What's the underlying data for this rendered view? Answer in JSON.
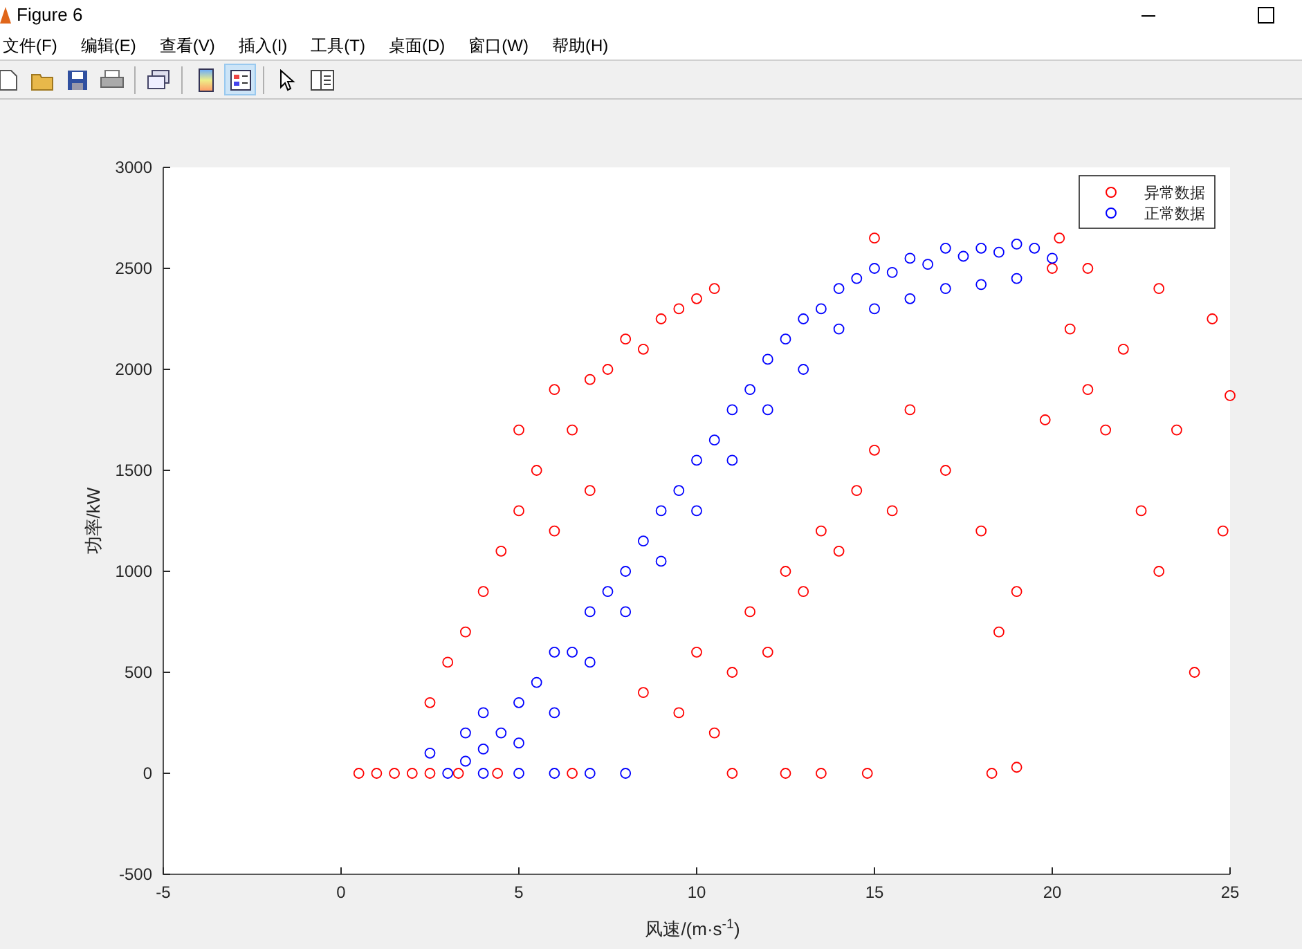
{
  "window": {
    "title": "Figure 6"
  },
  "menu": [
    "文件(F)",
    "编辑(E)",
    "查看(V)",
    "插入(I)",
    "工具(T)",
    "桌面(D)",
    "窗口(W)",
    "帮助(H)"
  ],
  "toolbar": [
    {
      "pressed": false
    },
    {
      "pressed": false
    },
    {
      "pressed": false
    },
    {
      "pressed": false
    },
    {
      "pressed": false
    },
    {
      "pressed": false
    },
    {
      "pressed": true
    },
    {
      "pressed": false
    },
    {
      "pressed": false
    }
  ],
  "figure": {
    "chart_data": {
      "type": "scatter",
      "legend": true,
      "xlabel": "风速/(m·s$^{-1}$)",
      "ylabel": "功率/kW",
      "xlim": [
        -5,
        25
      ],
      "ylim": [
        -500,
        3000
      ],
      "xticks": [
        -5,
        0,
        5,
        10,
        15,
        20,
        25
      ],
      "yticks": [
        -500,
        0,
        500,
        1000,
        1500,
        2000,
        2500,
        3000
      ],
      "series": [
        {
          "name": "异常数据",
          "color": "#ff0000",
          "x": [
            0.5,
            1,
            1.5,
            2,
            2.5,
            3.3,
            4.4,
            6.5,
            2.5,
            3,
            3.5,
            4,
            4.5,
            5,
            5,
            5.5,
            6,
            6,
            6.5,
            7,
            7,
            7.5,
            8,
            8.5,
            9,
            9.5,
            10,
            10.5,
            8.5,
            9.5,
            10,
            10.5,
            11,
            11.5,
            12,
            12.5,
            13,
            13.5,
            14,
            14.5,
            15,
            15.5,
            16,
            17,
            18,
            18.5,
            19,
            11,
            12.5,
            13.5,
            14.8,
            18.3,
            19,
            19.8,
            20,
            20.5,
            21,
            21.5,
            22,
            22.5,
            23,
            23.5,
            24,
            24.5,
            24.8,
            25,
            23,
            21,
            20.2,
            15
          ],
          "values": [
            0,
            0,
            0,
            0,
            0,
            0,
            0,
            0,
            350,
            550,
            700,
            900,
            1100,
            1300,
            1700,
            1500,
            1900,
            1200,
            1700,
            1950,
            1400,
            2000,
            2150,
            2100,
            2250,
            2300,
            2350,
            2400,
            400,
            300,
            600,
            200,
            500,
            800,
            600,
            1000,
            900,
            1200,
            1100,
            1400,
            1600,
            1300,
            1800,
            1500,
            1200,
            700,
            900,
            0,
            0,
            0,
            0,
            0,
            30,
            1750,
            2500,
            2200,
            1900,
            1700,
            2100,
            1300,
            1000,
            1700,
            500,
            2250,
            1200,
            1870,
            2400,
            2500,
            2650,
            2650
          ]
        },
        {
          "name": "正常数据",
          "color": "#0000ff",
          "x": [
            3,
            3.5,
            4,
            4,
            4.5,
            5,
            5,
            5.5,
            6,
            6,
            6.5,
            7,
            7,
            7.5,
            8,
            8,
            8.5,
            9,
            9,
            9.5,
            10,
            10,
            10.5,
            11,
            11,
            11.5,
            12,
            12,
            12.5,
            13,
            13,
            13.5,
            14,
            14,
            14.5,
            15,
            15,
            15.5,
            16,
            16,
            16.5,
            17,
            17,
            17.5,
            18,
            18,
            18.5,
            19,
            19,
            19.5,
            20,
            4,
            5,
            6,
            7,
            8,
            3.5,
            2.5
          ],
          "values": [
            0,
            60,
            120,
            300,
            200,
            350,
            150,
            450,
            300,
            600,
            600,
            800,
            550,
            900,
            1000,
            800,
            1150,
            1300,
            1050,
            1400,
            1550,
            1300,
            1650,
            1800,
            1550,
            1900,
            2050,
            1800,
            2150,
            2250,
            2000,
            2300,
            2400,
            2200,
            2450,
            2500,
            2300,
            2480,
            2550,
            2350,
            2520,
            2600,
            2400,
            2560,
            2600,
            2420,
            2580,
            2620,
            2450,
            2600,
            2550,
            0,
            0,
            0,
            0,
            0,
            200,
            100
          ]
        }
      ]
    }
  }
}
